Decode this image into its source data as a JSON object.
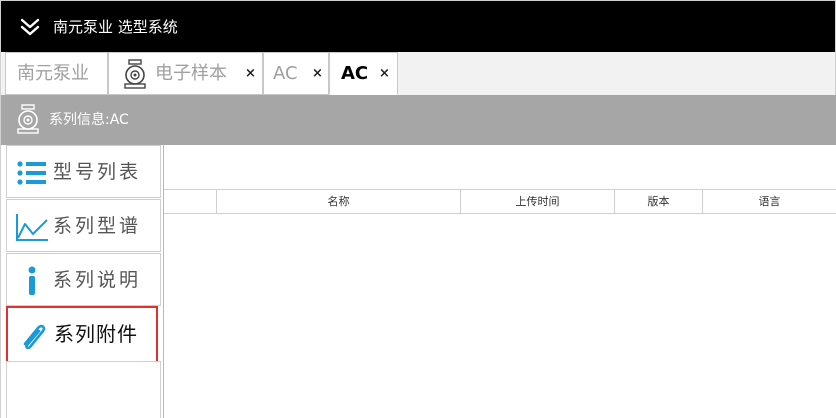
{
  "app": {
    "title": "南元泵业 选型系统"
  },
  "tabs": [
    {
      "label": "南元泵业",
      "closable": false,
      "active": false
    },
    {
      "label": "电子样本",
      "closable": true,
      "active": false,
      "icon": "pump-icon"
    },
    {
      "label": "AC",
      "closable": true,
      "active": false
    },
    {
      "label": "AC",
      "closable": true,
      "active": true
    }
  ],
  "close_glyph": "×",
  "info": {
    "text": "系列信息:AC",
    "icon": "pump-icon"
  },
  "sidebar": {
    "items": [
      {
        "label": "型号列表",
        "icon": "list-icon",
        "selected": false
      },
      {
        "label": "系列型谱",
        "icon": "line-chart-icon",
        "selected": false
      },
      {
        "label": "系列说明",
        "icon": "info-icon",
        "selected": false
      },
      {
        "label": "系列附件",
        "icon": "paperclip-icon",
        "selected": true
      }
    ]
  },
  "table": {
    "columns": [
      "",
      "名称",
      "上传时间",
      "版本",
      "语言"
    ],
    "rows": []
  },
  "colors": {
    "titlebar_bg": "#000000",
    "infobar_bg": "#a6a6a6",
    "accent_blue": "#1a9ad6",
    "selection_border": "#e03030"
  }
}
